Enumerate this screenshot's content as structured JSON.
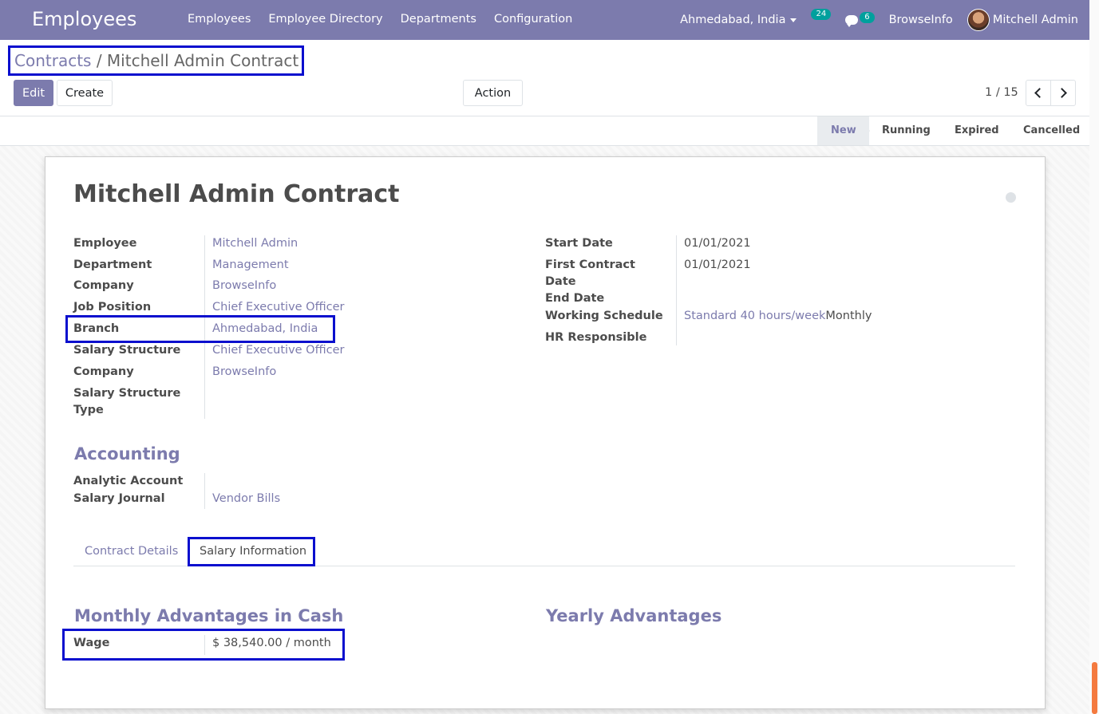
{
  "navbar": {
    "brand": "Employees",
    "menu": [
      "Employees",
      "Employee Directory",
      "Departments",
      "Configuration"
    ],
    "branch": "Ahmedabad, India",
    "activity_count": "24",
    "message_count": "6",
    "company": "BrowseInfo",
    "user": "Mitchell Admin"
  },
  "breadcrumb": {
    "parent": "Contracts",
    "separator": " / ",
    "current": "Mitchell Admin Contract"
  },
  "buttons": {
    "edit": "Edit",
    "create": "Create",
    "action": "Action"
  },
  "pager": {
    "value": "1 / 15"
  },
  "stages": [
    "New",
    "Running",
    "Expired",
    "Cancelled"
  ],
  "form": {
    "title": "Mitchell Admin Contract",
    "left": [
      {
        "label": "Employee",
        "value": "Mitchell Admin"
      },
      {
        "label": "Department",
        "value": "Management"
      },
      {
        "label": "Company",
        "value": "BrowseInfo"
      },
      {
        "label": "Job Position",
        "value": "Chief Executive Officer"
      },
      {
        "label": "Branch",
        "value": "Ahmedabad, India"
      },
      {
        "label": "Salary Structure",
        "value": "Chief Executive Officer"
      },
      {
        "label": "Company",
        "value": "BrowseInfo"
      },
      {
        "label": "Salary Structure Type",
        "value": ""
      }
    ],
    "right": {
      "start_date_label": "Start Date",
      "start_date": "01/01/2021",
      "first_contract_label": "First Contract Date",
      "first_contract": "01/01/2021",
      "end_date_label": "End Date",
      "end_date": "",
      "schedule_label": "Working Schedule",
      "schedule": "Standard 40 hours/week",
      "schedule_period": "Monthly",
      "hr_label": "HR Responsible",
      "hr": ""
    },
    "accounting": {
      "title": "Accounting",
      "analytic_label": "Analytic Account",
      "analytic": "",
      "journal_label": "Salary Journal",
      "journal": "Vendor Bills"
    },
    "tabs": [
      "Contract Details",
      "Salary Information"
    ],
    "salary": {
      "monthly_title": "Monthly Advantages in Cash",
      "yearly_title": "Yearly Advantages",
      "wage_label": "Wage",
      "wage": "$ 38,540.00 / month"
    }
  }
}
